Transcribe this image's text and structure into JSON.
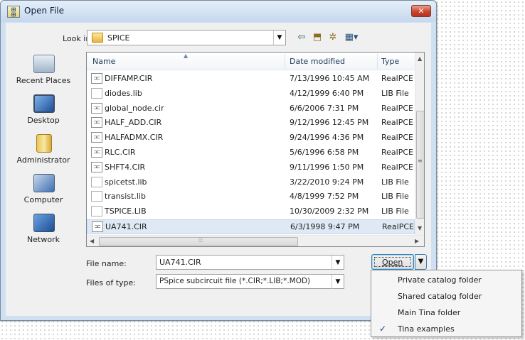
{
  "window": {
    "title": "Open File",
    "close_glyph": "✕"
  },
  "lookin": {
    "label": "Look in:",
    "value": "SPICE"
  },
  "toolbar": {
    "icons": [
      "back-icon",
      "up-folder-icon",
      "new-folder-icon",
      "views-menu-icon"
    ]
  },
  "places": [
    {
      "label": "Recent Places",
      "icon": "recent-places-icon"
    },
    {
      "label": "Desktop",
      "icon": "desktop-icon"
    },
    {
      "label": "Administrator",
      "icon": "user-folder-icon"
    },
    {
      "label": "Computer",
      "icon": "computer-icon"
    },
    {
      "label": "Network",
      "icon": "network-icon"
    }
  ],
  "filelist": {
    "columns": [
      "Name",
      "Date modified",
      "Type"
    ],
    "rows": [
      {
        "name": "DIFFAMP.CIR",
        "date": "7/13/1996 10:45 AM",
        "type": "RealPCE"
      },
      {
        "name": "diodes.lib",
        "date": "4/12/1999 6:40 PM",
        "type": "LIB File"
      },
      {
        "name": "global_node.cir",
        "date": "6/6/2006 7:31 PM",
        "type": "RealPCE"
      },
      {
        "name": "HALF_ADD.CIR",
        "date": "9/12/1996 12:45 PM",
        "type": "RealPCE"
      },
      {
        "name": "HALFADMX.CIR",
        "date": "9/24/1996 4:36 PM",
        "type": "RealPCE"
      },
      {
        "name": "RLC.CIR",
        "date": "5/6/1996 6:58 PM",
        "type": "RealPCE"
      },
      {
        "name": "SHFT4.CIR",
        "date": "9/11/1996 1:50 PM",
        "type": "RealPCE"
      },
      {
        "name": "spicetst.lib",
        "date": "3/22/2010 9:24 PM",
        "type": "LIB File"
      },
      {
        "name": "transist.lib",
        "date": "4/8/1999 7:52 PM",
        "type": "LIB File"
      },
      {
        "name": "TSPICE.LIB",
        "date": "10/30/2009 2:32 PM",
        "type": "LIB File"
      },
      {
        "name": "UA741.CIR",
        "date": "6/3/1998 9:47 PM",
        "type": "RealPCE"
      }
    ],
    "selected_row": "UA741.CIR"
  },
  "filename": {
    "label": "File name:",
    "value": "UA741.CIR"
  },
  "filetype": {
    "label": "Files of type:",
    "value": "PSpice subcircuit file (*.CIR;*.LIB;*.MOD)"
  },
  "open_button": {
    "label": "Open"
  },
  "menu": {
    "items": [
      {
        "label": "Private catalog folder",
        "checked": false
      },
      {
        "label": "Shared catalog folder",
        "checked": false
      },
      {
        "label": "Main Tina folder",
        "checked": false
      },
      {
        "label": "Tina examples",
        "checked": true
      }
    ],
    "check_glyph": "✓"
  },
  "colors": {
    "accent": "#3c7fb1",
    "selection": "#dfe9f6",
    "titlebar": "#cfe0f3"
  }
}
